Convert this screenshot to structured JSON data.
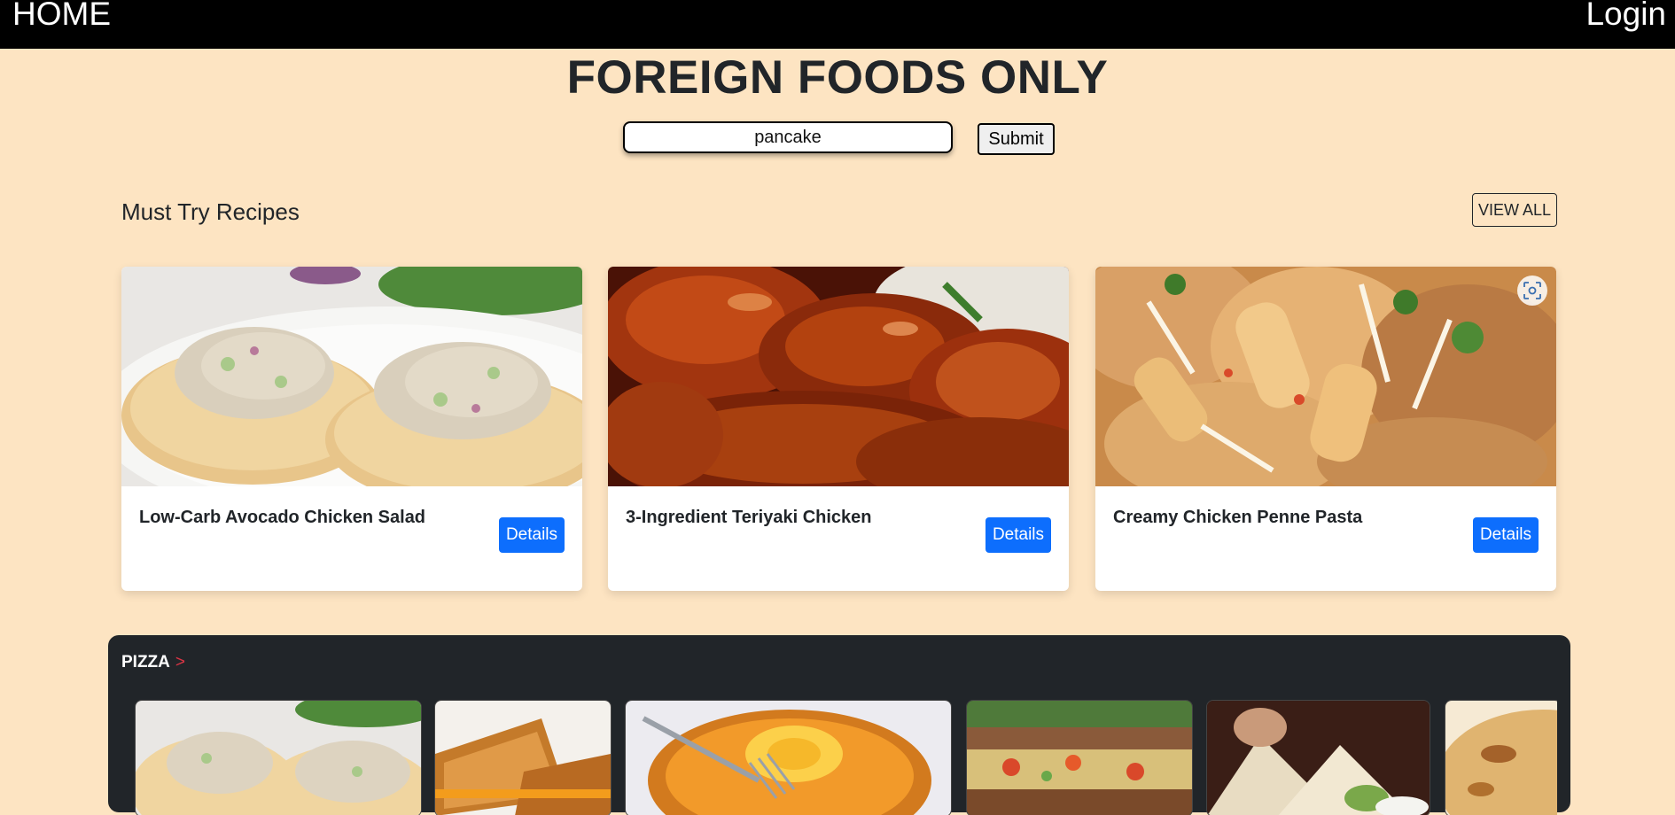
{
  "nav": {
    "home_label": "HOME",
    "login_label": "Login"
  },
  "header": {
    "title": "FOREIGN FOODS ONLY"
  },
  "search": {
    "value": "pancake",
    "submit_label": "Submit"
  },
  "recipes": {
    "heading": "Must Try Recipes",
    "view_all_label": "VIEW ALL",
    "cards": [
      {
        "title": "Low-Carb Avocado Chicken Salad",
        "button": "Details",
        "image": "chicken-salad-on-naan"
      },
      {
        "title": "3-Ingredient Teriyaki Chicken",
        "button": "Details",
        "image": "teriyaki-chicken"
      },
      {
        "title": "Creamy Chicken Penne Pasta",
        "button": "Details",
        "image": "penne-pasta"
      }
    ],
    "overlay_icon": "scan-icon"
  },
  "category": {
    "title": "PIZZA",
    "arrow": ">",
    "thumbnails": [
      "chicken-salad-on-naan",
      "grilled-cheese",
      "egg-in-toast",
      "veggie-sandwich",
      "quesadilla",
      "flatbread"
    ]
  },
  "colors": {
    "background": "#fde4c2",
    "navbar": "#000000",
    "accent_blue": "#0d6efd",
    "dark_section": "#212529",
    "arrow_red": "#dc3545"
  }
}
